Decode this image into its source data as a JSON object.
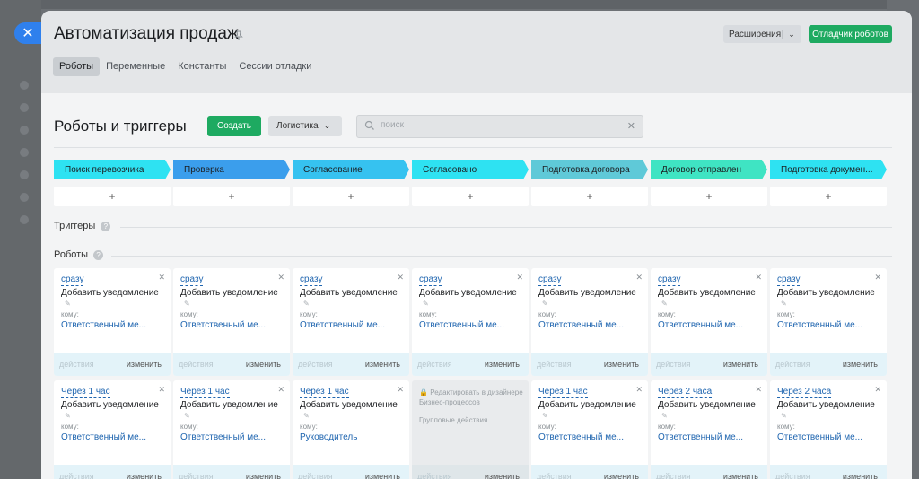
{
  "header": {
    "title": "Автоматизация продаж",
    "extensions_label": "Расширения",
    "debugger_label": "Отладчик роботов"
  },
  "tabs": [
    "Роботы",
    "Переменные",
    "Константы",
    "Сессии отладки"
  ],
  "toolbar": {
    "section_title": "Роботы и триггеры",
    "create_label": "Создать",
    "category_label": "Логистика",
    "search_placeholder": "поиск"
  },
  "stages": [
    {
      "label": "Поиск перевозчика",
      "color": "#2ee2f2"
    },
    {
      "label": "Проверка",
      "color": "#3b9eec"
    },
    {
      "label": "Согласование",
      "color": "#36c2f0"
    },
    {
      "label": "Согласовано",
      "color": "#2ee2f2"
    },
    {
      "label": "Подготовка договора",
      "color": "#5fc9d8"
    },
    {
      "label": "Договор отправлен",
      "color": "#3fe4c3"
    },
    {
      "label": "Подготовка докумен...",
      "color": "#2ee2f2"
    }
  ],
  "add_symbol": "+",
  "triggers_title": "Триггеры",
  "robots_title": "Роботы",
  "card_labels": {
    "komu": "кому:",
    "actions": "действия",
    "edit": "изменить"
  },
  "robots_row1": [
    {
      "when": "сразу",
      "title": "Добавить уведомление",
      "who": "Ответственный ме..."
    },
    {
      "when": "сразу",
      "title": "Добавить уведомление",
      "who": "Ответственный ме..."
    },
    {
      "when": "сразу",
      "title": "Добавить уведомление",
      "who": "Ответственный ме..."
    },
    {
      "when": "сразу",
      "title": "Добавить уведомление",
      "who": "Ответственный ме..."
    },
    {
      "when": "сразу",
      "title": "Добавить уведомление",
      "who": "Ответственный ме..."
    },
    {
      "when": "сразу",
      "title": "Добавить уведомление",
      "who": "Ответственный ме..."
    },
    {
      "when": "сразу",
      "title": "Добавить уведомление",
      "who": "Ответственный ме..."
    }
  ],
  "robots_row2": [
    {
      "when": "Через 1 час",
      "title": "Добавить уведомление",
      "who": "Ответственный ме..."
    },
    {
      "when": "Через 1 час",
      "title": "Добавить уведомление",
      "who": "Ответственный ме..."
    },
    {
      "when": "Через 1 час",
      "title": "Добавить уведомление",
      "who": "Руководитель"
    },
    {
      "locked": true
    },
    {
      "when": "Через 1 час",
      "title": "Добавить уведомление",
      "who": "Ответственный ме..."
    },
    {
      "when": "Через 2 часа",
      "title": "Добавить уведомление",
      "who": "Ответственный ме..."
    },
    {
      "when": "Через 2 часа",
      "title": "Добавить уведомление",
      "who": "Ответственный ме..."
    }
  ],
  "locked_card": {
    "text": "Редактировать в дизайнере Бизнес-процессов",
    "group_actions": "Групповые действия"
  }
}
